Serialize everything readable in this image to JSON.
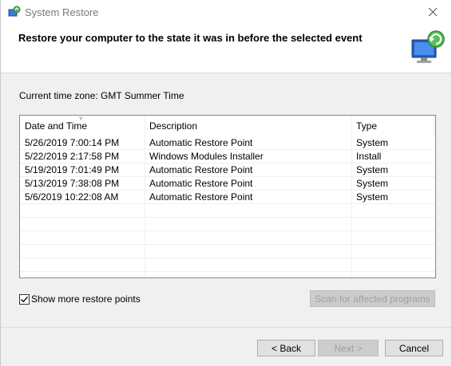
{
  "window": {
    "title": "System Restore"
  },
  "header": {
    "heading": "Restore your computer to the state it was in before the selected event"
  },
  "timezone_label": "Current time zone: GMT Summer Time",
  "table": {
    "columns": [
      "Date and Time",
      "Description",
      "Type"
    ],
    "rows": [
      [
        "5/26/2019 7:00:14 PM",
        "Automatic Restore Point",
        "System"
      ],
      [
        "5/22/2019 2:17:58 PM",
        "Windows Modules Installer",
        "Install"
      ],
      [
        "5/19/2019 7:01:49 PM",
        "Automatic Restore Point",
        "System"
      ],
      [
        "5/13/2019 7:38:08 PM",
        "Automatic Restore Point",
        "System"
      ],
      [
        "5/6/2019 10:22:08 AM",
        "Automatic Restore Point",
        "System"
      ]
    ],
    "sort_indicator": "˅"
  },
  "show_more": {
    "label": "Show more restore points",
    "checked": true
  },
  "buttons": {
    "scan": "Scan for affected programs",
    "back": "< Back",
    "next": "Next >",
    "cancel": "Cancel"
  },
  "icons": {
    "app": "system-restore-icon",
    "header": "monitor-restore-icon",
    "close": "close-icon"
  }
}
